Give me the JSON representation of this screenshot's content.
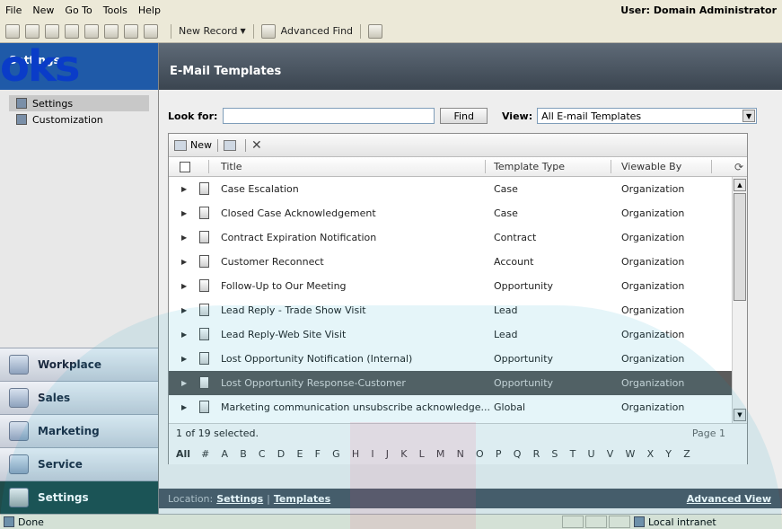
{
  "menu": {
    "items": [
      "File",
      "New",
      "Go To",
      "Tools",
      "Help"
    ],
    "user": "User: Domain Administrator"
  },
  "toolbar": {
    "new_record": "New Record",
    "advanced_find": "Advanced Find"
  },
  "leftnav": {
    "overlay_text": "oks",
    "header": "Settings",
    "items": [
      {
        "label": "Settings",
        "selected": true
      },
      {
        "label": "Customization",
        "selected": false
      }
    ],
    "wunderbar": [
      {
        "label": "Workplace",
        "active": false
      },
      {
        "label": "Sales",
        "active": false
      },
      {
        "label": "Marketing",
        "active": false
      },
      {
        "label": "Service",
        "active": false
      },
      {
        "label": "Settings",
        "active": true
      }
    ]
  },
  "main": {
    "title": "E-Mail Templates",
    "look_for_label": "Look for:",
    "search_value": "",
    "find_label": "Find",
    "view_label": "View:",
    "view_value": "All E-mail Templates",
    "grid_toolbar": {
      "new_label": "New"
    },
    "columns": {
      "title": "Title",
      "type": "Template Type",
      "viewable": "Viewable By"
    },
    "rows": [
      {
        "title": "Case Escalation",
        "type": "Case",
        "viewable": "Organization",
        "selected": false
      },
      {
        "title": "Closed Case Acknowledgement",
        "type": "Case",
        "viewable": "Organization",
        "selected": false
      },
      {
        "title": "Contract Expiration Notification",
        "type": "Contract",
        "viewable": "Organization",
        "selected": false
      },
      {
        "title": "Customer Reconnect",
        "type": "Account",
        "viewable": "Organization",
        "selected": false
      },
      {
        "title": "Follow-Up to Our Meeting",
        "type": "Opportunity",
        "viewable": "Organization",
        "selected": false
      },
      {
        "title": "Lead Reply - Trade Show Visit",
        "type": "Lead",
        "viewable": "Organization",
        "selected": false
      },
      {
        "title": "Lead Reply-Web Site Visit",
        "type": "Lead",
        "viewable": "Organization",
        "selected": false
      },
      {
        "title": "Lost Opportunity Notification (Internal)",
        "type": "Opportunity",
        "viewable": "Organization",
        "selected": false
      },
      {
        "title": "Lost Opportunity Response-Customer",
        "type": "Opportunity",
        "viewable": "Organization",
        "selected": true
      },
      {
        "title": "Marketing communication unsubscribe acknowledge...",
        "type": "Global",
        "viewable": "Organization",
        "selected": false
      }
    ],
    "selection_status": "1 of 19 selected.",
    "page": "Page 1",
    "alpha": [
      "All",
      "#",
      "A",
      "B",
      "C",
      "D",
      "E",
      "F",
      "G",
      "H",
      "I",
      "J",
      "K",
      "L",
      "M",
      "N",
      "O",
      "P",
      "Q",
      "R",
      "S",
      "T",
      "U",
      "V",
      "W",
      "X",
      "Y",
      "Z"
    ]
  },
  "location": {
    "label": "Location:",
    "links": [
      "Settings",
      "Templates"
    ],
    "advanced_view": "Advanced View"
  },
  "status": {
    "text": "Done",
    "zone": "Local intranet"
  }
}
